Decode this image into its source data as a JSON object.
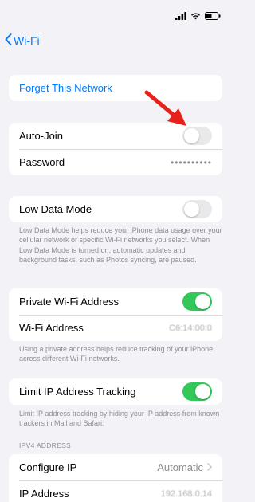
{
  "status": {
    "icons": [
      "signal-icon",
      "wifi-icon",
      "battery-icon"
    ]
  },
  "nav": {
    "back_label": "Wi-Fi"
  },
  "forget": {
    "label": "Forget This Network"
  },
  "auto_join": {
    "label": "Auto-Join",
    "enabled": false
  },
  "password": {
    "label": "Password",
    "value": "••••••••••"
  },
  "low_data": {
    "label": "Low Data Mode",
    "enabled": false,
    "footnote": "Low Data Mode helps reduce your iPhone data usage over your cellular network or specific Wi-Fi networks you select. When Low Data Mode is turned on, automatic updates and background tasks, such as Photos syncing, are paused."
  },
  "private_address": {
    "label": "Private Wi-Fi Address",
    "enabled": true,
    "wifi_address_label": "Wi-Fi Address",
    "wifi_address_value": "C6:14:00:0",
    "footnote": "Using a private address helps reduce tracking of your iPhone across different Wi-Fi networks."
  },
  "limit_tracking": {
    "label": "Limit IP Address Tracking",
    "enabled": true,
    "footnote": "Limit IP address tracking by hiding your IP address from known trackers in Mail and Safari."
  },
  "ipv4": {
    "header": "IPV4 ADDRESS",
    "configure_label": "Configure IP",
    "configure_value": "Automatic",
    "ip_label": "IP Address",
    "ip_value": "192.168.0.14"
  },
  "colors": {
    "accent": "#007aff",
    "toggle_on": "#34c759",
    "toggle_off": "#e9e9eb",
    "annotation_arrow": "#e8201c",
    "background": "#f2f2f7"
  }
}
